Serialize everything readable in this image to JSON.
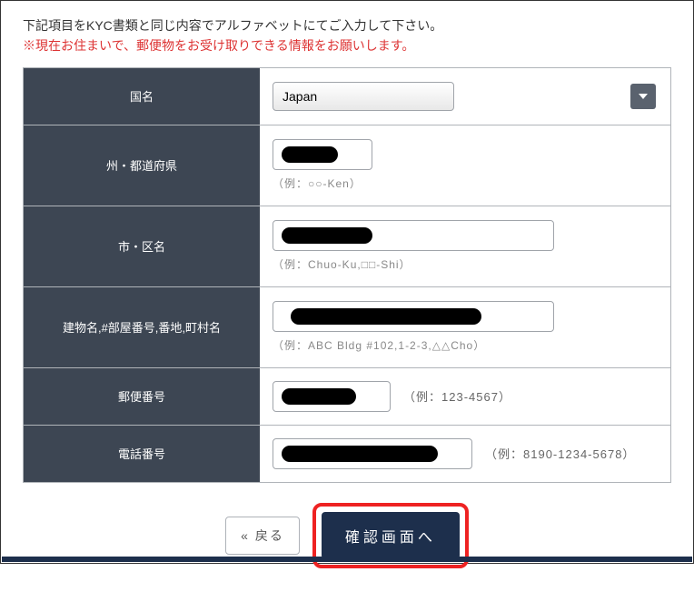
{
  "header": {
    "instruction": "下記項目をKYC書類と同じ内容でアルファベットにてご入力して下さい。",
    "warning": "※現在お住まいで、郵便物をお受け取りできる情報をお願いします。"
  },
  "form": {
    "country": {
      "label": "国名",
      "value": "Japan",
      "options": [
        "Japan"
      ]
    },
    "state": {
      "label": "州・都道府県",
      "value": "",
      "hint": "（例：○○-Ken）"
    },
    "city": {
      "label": "市・区名",
      "value": "",
      "hint": "（例：Chuo-Ku,□□-Shi）"
    },
    "address": {
      "label": "建物名,#部屋番号,番地,町村名",
      "value": "",
      "hint": "（例：ABC Bldg #102,1-2-3,△△Cho）"
    },
    "zip": {
      "label": "郵便番号",
      "value": "",
      "hint": "（例：123-4567）"
    },
    "tel": {
      "label": "電話番号",
      "value": "",
      "hint": "（例：8190-1234-5678）"
    }
  },
  "buttons": {
    "back": "« 戻る",
    "confirm": "確認画面へ"
  }
}
